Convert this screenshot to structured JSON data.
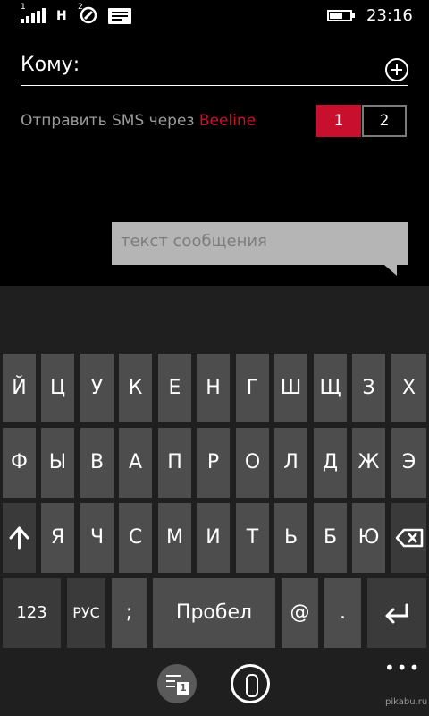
{
  "status_bar": {
    "sim1_label": "1",
    "network": "H",
    "sim2_label": "2",
    "battery_level": 0.5,
    "time": "23:16"
  },
  "recipient": {
    "label": "Кому:",
    "add_icon": "plus-circle-icon"
  },
  "sms_via": {
    "prefix": "Отправить SMS через ",
    "carrier": "Beeline",
    "carrier_color": "#c8102e",
    "sim_options": [
      "1",
      "2"
    ],
    "selected_sim": "1"
  },
  "message": {
    "placeholder": "текст сообщения"
  },
  "keyboard": {
    "row1": [
      "Й",
      "Ц",
      "У",
      "К",
      "Е",
      "Н",
      "Г",
      "Ш",
      "Щ",
      "З",
      "Х"
    ],
    "row2": [
      "Ф",
      "Ы",
      "В",
      "А",
      "П",
      "Р",
      "О",
      "Л",
      "Д",
      "Ж",
      "Э"
    ],
    "row3": [
      "Я",
      "Ч",
      "С",
      "М",
      "И",
      "Т",
      "Ь",
      "Б",
      "Ю"
    ],
    "shift_icon": "shift-arrow-icon",
    "backspace_icon": "backspace-icon",
    "key_123": "123",
    "key_lang": "РУС",
    "key_semicolon": ";",
    "key_space": "Пробел",
    "key_at": "@",
    "key_dot": ".",
    "enter_icon": "enter-icon"
  },
  "app_bar": {
    "more": "•••",
    "attach_icon": "paperclip-icon",
    "conversations_icon": "conversations-icon",
    "conversations_badge": "1"
  },
  "watermark": "pikabu.ru"
}
